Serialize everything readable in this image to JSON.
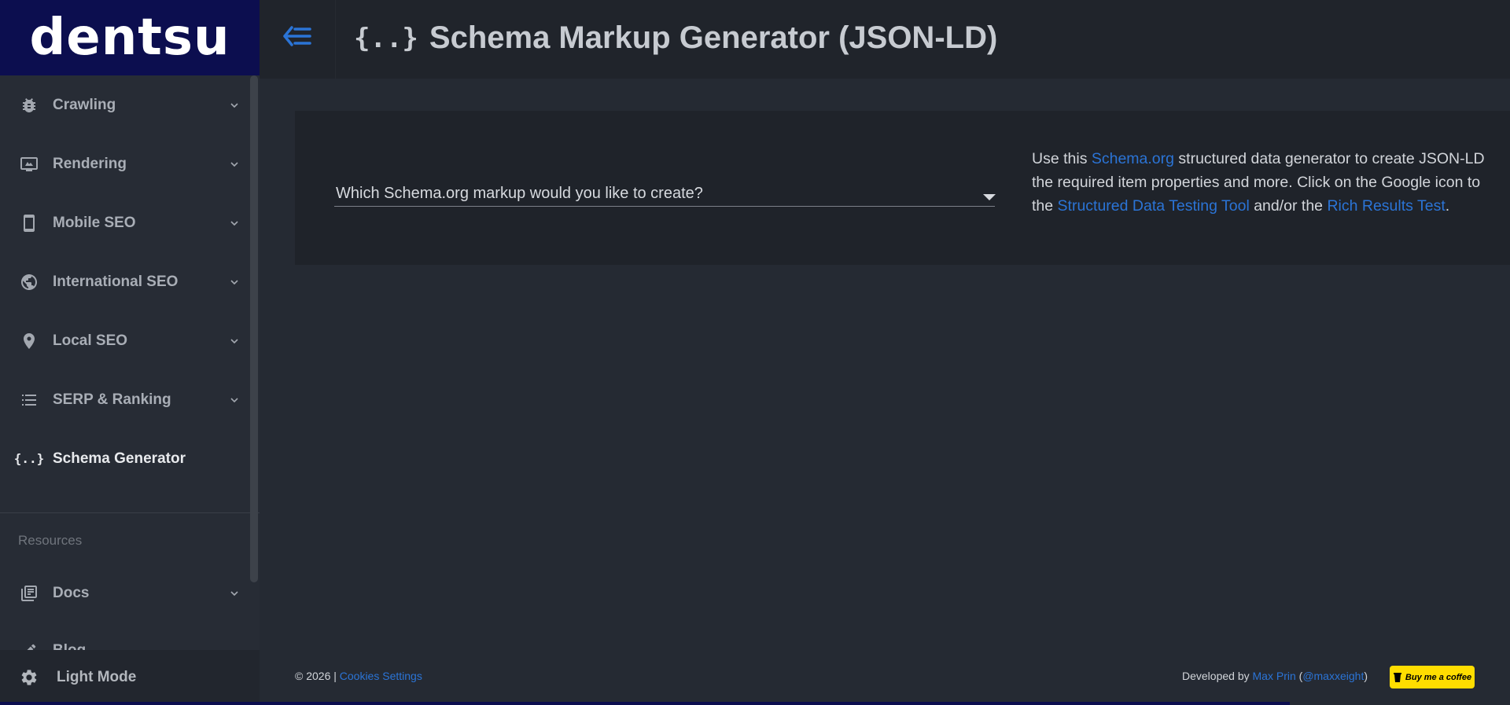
{
  "brand": {
    "logo_text": "dentsu"
  },
  "header": {
    "title_icon": "{..}",
    "title": "Schema Markup Generator (JSON-LD)",
    "collapse_icon": "menu-collapse-icon"
  },
  "sidebar": {
    "items": [
      {
        "label": "Crawling",
        "icon": "bug-icon"
      },
      {
        "label": "Rendering",
        "icon": "monitor-icon"
      },
      {
        "label": "Mobile SEO",
        "icon": "phone-icon"
      },
      {
        "label": "International SEO",
        "icon": "globe-icon"
      },
      {
        "label": "Local SEO",
        "icon": "map-pin-icon"
      },
      {
        "label": "SERP & Ranking",
        "icon": "list-icon"
      },
      {
        "label": "Schema Generator",
        "icon": "braces-icon",
        "active": true
      }
    ],
    "resources_heading": "Resources",
    "resource_items": [
      {
        "label": "Docs",
        "icon": "docs-icon"
      },
      {
        "label": "Blog",
        "icon": "pencil-icon"
      }
    ],
    "light_mode_label": "Light Mode"
  },
  "main": {
    "select_placeholder": "Which Schema.org markup would you like to create?",
    "description": {
      "part1": "Use this ",
      "link1": "Schema.org",
      "part2": " structured data generator to create JSON-LD",
      "line2": "the required item properties and more. Click on the Google icon to",
      "part3": "the ",
      "link2": "Structured Data Testing Tool",
      "part4": " and/or the ",
      "link3": "Rich Results Test",
      "part5": "."
    }
  },
  "footer": {
    "copyright": "© 2026 | ",
    "cookies_link": "Cookies Settings",
    "developed_by": "Developed by ",
    "author_link": "Max Prin",
    "paren_open": " (",
    "handle_link": "@maxxeight",
    "paren_close": ")",
    "coffee_label": "Buy me a coffee"
  },
  "colors": {
    "accent": "#2b74d6",
    "brand": "#0c0e4f",
    "coffee": "#ffdd00"
  }
}
